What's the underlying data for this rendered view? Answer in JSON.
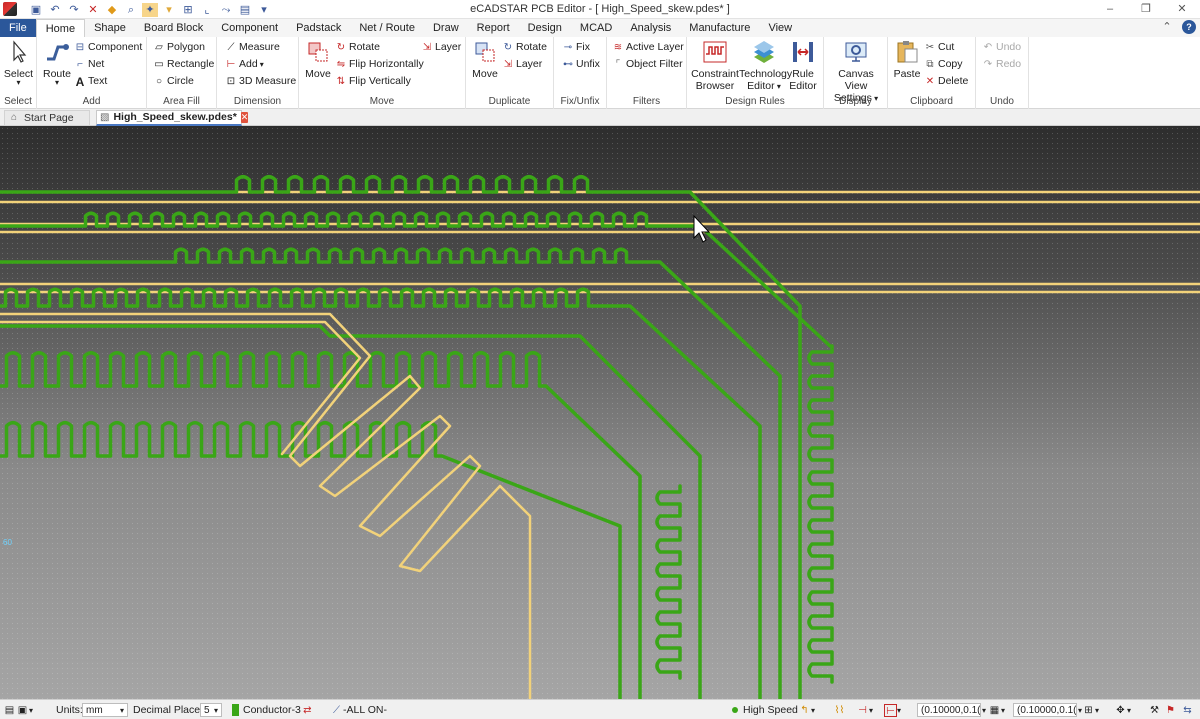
{
  "window": {
    "title": "eCADSTAR PCB Editor - [ High_Speed_skew.pdes* ]",
    "qat_icons": [
      "save-icon",
      "undo-icon",
      "redo-icon",
      "delete-icon",
      "highlight-icon",
      "zoom-icon",
      "snap-icon",
      "comment-icon",
      "grid-icon",
      "measure-icon",
      "route-icon",
      "report-icon",
      "customize-icon"
    ],
    "controls": [
      "–",
      "❐",
      "✕"
    ]
  },
  "menu": {
    "file": "File",
    "tabs": [
      "Home",
      "Shape",
      "Board Block",
      "Component",
      "Padstack",
      "Net / Route",
      "Draw",
      "Report",
      "Design",
      "MCAD",
      "Analysis",
      "Manufacture",
      "View"
    ],
    "active": "Home"
  },
  "ribbon": {
    "select": {
      "button": "Select",
      "group": "Select"
    },
    "add": {
      "route": "Route",
      "component": "Component",
      "net": "Net",
      "text": "Text",
      "group": "Add"
    },
    "area_fill": {
      "polygon": "Polygon",
      "rectangle": "Rectangle",
      "circle": "Circle",
      "group": "Area Fill"
    },
    "dimension": {
      "measure": "Measure",
      "add": "Add",
      "measure3d": "3D Measure",
      "group": "Dimension"
    },
    "move": {
      "move": "Move",
      "rotate": "Rotate",
      "flip_h": "Flip Horizontally",
      "flip_v": "Flip Vertically",
      "layer": "Layer",
      "group": "Move"
    },
    "duplicate": {
      "move": "Move",
      "rotate": "Rotate",
      "layer": "Layer",
      "group": "Duplicate"
    },
    "fix_unfix": {
      "fix": "Fix",
      "unfix": "Unfix",
      "group": "Fix/Unfix"
    },
    "filters": {
      "active_layer": "Active Layer",
      "object_filter": "Object Filter",
      "group": "Filters"
    },
    "design_rules": {
      "constraint_browser_1": "Constraint",
      "constraint_browser_2": "Browser",
      "technology_editor_1": "Technology",
      "technology_editor_2": "Editor",
      "rule_editor_1": "Rule",
      "rule_editor_2": "Editor",
      "group": "Design Rules"
    },
    "display": {
      "canvas_view_1": "Canvas View",
      "canvas_view_2": "Settings",
      "group": "Display"
    },
    "clipboard": {
      "paste": "Paste",
      "cut": "Cut",
      "copy": "Copy",
      "delete": "Delete",
      "group": "Clipboard"
    },
    "undo": {
      "undo": "Undo",
      "redo": "Redo",
      "group": "Undo"
    }
  },
  "doc_tabs": [
    {
      "label": "Start Page"
    },
    {
      "label": "High_Speed_skew.pdes*"
    }
  ],
  "canvas": {
    "ruler_label": "60",
    "colors": {
      "trace_green": "#3aa617",
      "trace_yellow": "#f2d27a"
    }
  },
  "status": {
    "units_label": "Units:",
    "units_value": "mm",
    "decimal_label": "Decimal Places:",
    "decimal_value": "5",
    "layer": "Conductor-3",
    "filter": "-ALL ON-",
    "mode": "High Speed",
    "grid1": "(0.10000,0.1(",
    "grid2": "(0.10000,0.1("
  }
}
